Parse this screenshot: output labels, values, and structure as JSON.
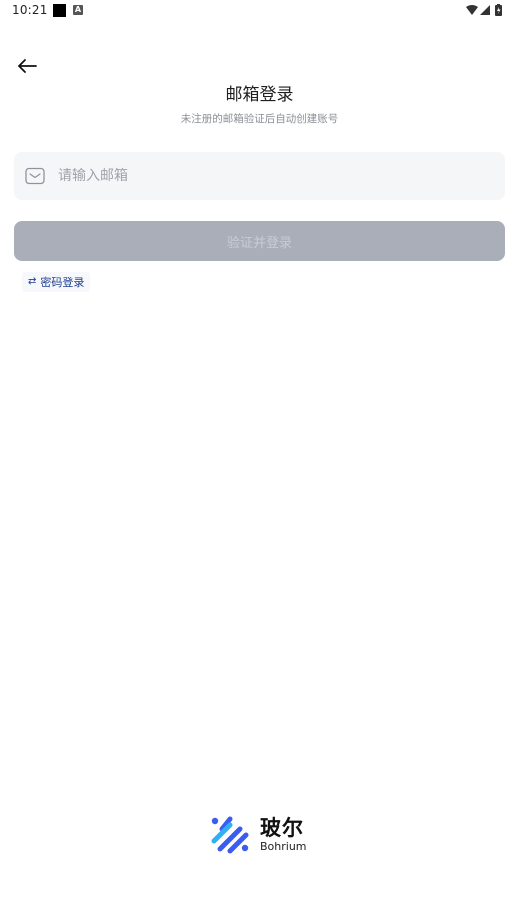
{
  "status_bar": {
    "time": "10:21",
    "notification_letter": "A"
  },
  "header": {
    "title": "邮箱登录",
    "subtitle": "未注册的邮箱验证后自动创建账号"
  },
  "email_field": {
    "value": "",
    "placeholder": "请输入邮箱"
  },
  "submit": {
    "label": "验证并登录",
    "state": "disabled"
  },
  "switch_login": {
    "icon": "⇄",
    "label": "密码登录"
  },
  "brand": {
    "name_cn": "玻尔",
    "name_en": "Bohrium"
  },
  "colors": {
    "button_disabled": "#a9aeb8",
    "link": "#1e3d8f",
    "input_bg": "#f5f6f8",
    "brand_blue": "#3a5cf0",
    "brand_light_blue": "#2fb0f5"
  }
}
